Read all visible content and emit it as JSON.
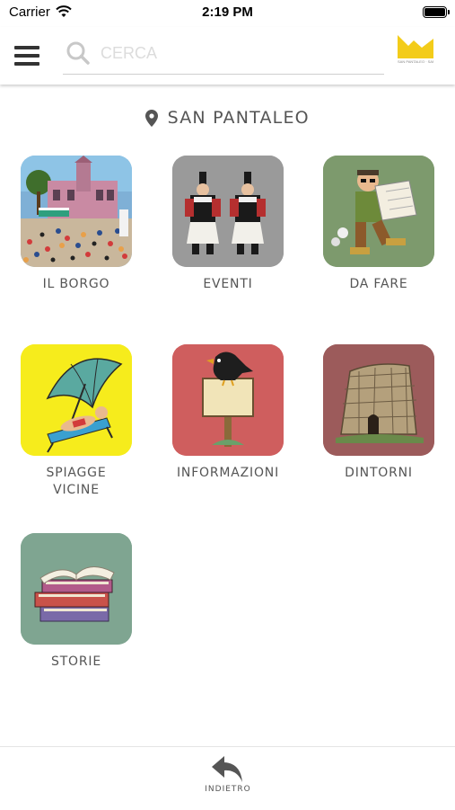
{
  "status_bar": {
    "carrier": "Carrier",
    "time": "2:19 PM"
  },
  "header": {
    "search_placeholder": "CERCA",
    "logo_text": "SAN PANTALEO · SARDEGNA · ITALIA"
  },
  "location": {
    "title": "SAN PANTALEO"
  },
  "tiles": [
    {
      "label": "IL BORGO",
      "icon": "village-painting"
    },
    {
      "label": "EVENTI",
      "icon": "costumed-dancers"
    },
    {
      "label": "DA FARE",
      "icon": "hiker-with-map"
    },
    {
      "label_line1": "SPIAGGE",
      "label_line2": "VICINE",
      "icon": "beach-umbrella"
    },
    {
      "label": "INFORMAZIONI",
      "icon": "crow-on-signboard"
    },
    {
      "label": "DINTORNI",
      "icon": "nuraghe-tower"
    },
    {
      "label": "STORIE",
      "icon": "book-stack"
    }
  ],
  "bottom_bar": {
    "back_label": "INDIETRO"
  },
  "colors": {
    "logo_yellow": "#f3cc1a",
    "tile_eventi_bg": "#9a9a9a",
    "tile_dafare_bg": "#7d9a6d",
    "tile_spiagge_bg": "#f6ec1c",
    "tile_info_bg": "#cf5e5e",
    "tile_dintorni_bg": "#9c5b5b",
    "tile_storie_bg": "#7fa591"
  }
}
